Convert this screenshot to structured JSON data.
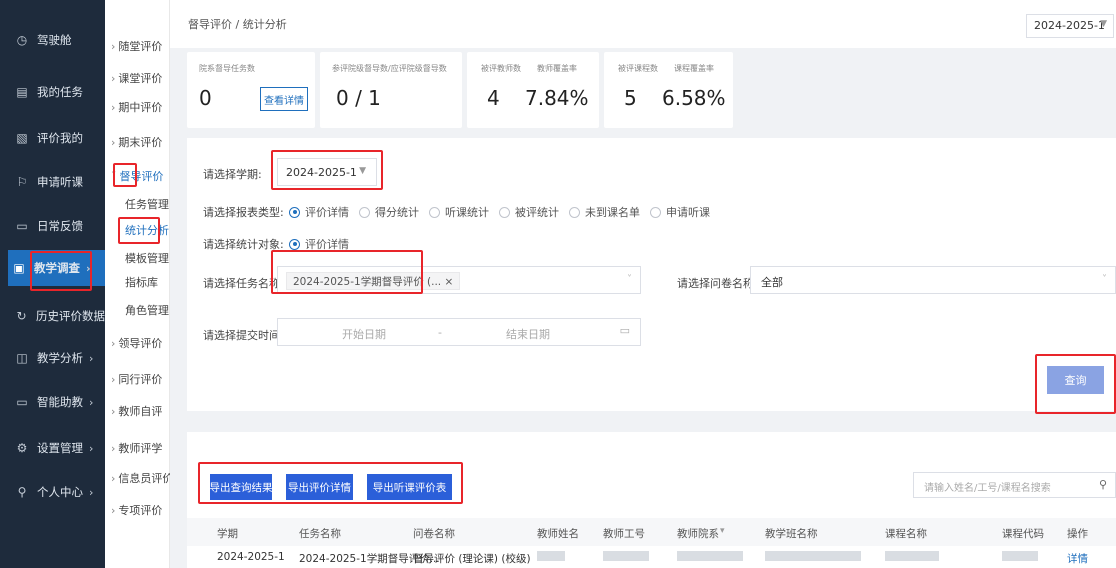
{
  "sidebar": {
    "items": [
      {
        "label": "驾驶舱",
        "icon": "clock-icon"
      },
      {
        "label": "我的任务",
        "icon": "list-icon"
      },
      {
        "label": "评价我的",
        "icon": "evaluate-icon"
      },
      {
        "label": "申请听课",
        "icon": "flag-icon"
      },
      {
        "label": "日常反馈",
        "icon": "feedback-icon"
      },
      {
        "label": "教学调查",
        "icon": "survey-icon",
        "arrow": "›"
      },
      {
        "label": "历史评价数据",
        "icon": "history-icon"
      },
      {
        "label": "教学分析",
        "icon": "chart-icon",
        "arrow": "›"
      },
      {
        "label": "智能助教",
        "icon": "monitor-icon",
        "arrow": "›"
      },
      {
        "label": "设置管理",
        "icon": "settings-icon",
        "arrow": "›"
      },
      {
        "label": "个人中心",
        "icon": "user-icon",
        "arrow": "›"
      }
    ]
  },
  "submenu": {
    "items": [
      {
        "label": "随堂评价"
      },
      {
        "label": "课堂评价"
      },
      {
        "label": "期中评价"
      },
      {
        "label": "期末评价"
      },
      {
        "label": "督导评价"
      },
      {
        "label": "领导评价"
      },
      {
        "label": "同行评价"
      },
      {
        "label": "教师自评"
      },
      {
        "label": "教师评学"
      },
      {
        "label": "信息员评价"
      },
      {
        "label": "专项评价"
      }
    ],
    "children": [
      "任务管理",
      "统计分析",
      "模板管理",
      "指标库",
      "角色管理"
    ]
  },
  "header": {
    "breadcrumb": "督导评价 / 统计分析",
    "term": "2024-2025-1"
  },
  "stats": [
    {
      "label": "院系督导任务数",
      "value": "0",
      "button": "查看详情"
    },
    {
      "label": "参评院级督导数/应评院级督导数",
      "value": "0 / 1"
    },
    {
      "label": "被评教师数",
      "value": "4"
    },
    {
      "label": "教师覆盖率",
      "value": "7.84%"
    },
    {
      "label": "被评课程数",
      "value": "5"
    },
    {
      "label": "课程覆盖率",
      "value": "6.58%"
    }
  ],
  "filters": {
    "term_label": "请选择学期:",
    "term_value": "2024-2025-1",
    "report_type_label": "请选择报表类型:",
    "report_types": [
      "评价详情",
      "得分统计",
      "听课统计",
      "被评统计",
      "未到课名单",
      "申请听课"
    ],
    "target_label": "请选择统计对象:",
    "target_value": "评价详情",
    "task_label": "请选择任务名称:",
    "task_tag": "2024-2025-1学期督导评价 (... ×",
    "questionnaire_label": "请选择问卷名称:",
    "questionnaire_value": "全部",
    "time_label": "请选择提交时间:",
    "start_placeholder": "开始日期",
    "separator": "-",
    "end_placeholder": "结束日期",
    "query_button": "查询"
  },
  "table": {
    "export_buttons": [
      "导出查询结果",
      "导出评价详情",
      "导出听课评价表"
    ],
    "search_placeholder": "请输入姓名/工号/课程名搜索",
    "columns": [
      "学期",
      "任务名称",
      "问卷名称",
      "教师姓名",
      "教师工号",
      "教师院系",
      "教学班名称",
      "课程名称",
      "课程代码",
      "操作"
    ],
    "rows": [
      {
        "term": "2024-2025-1",
        "task": "2024-2025-1学期督导评价...",
        "questionnaire": "督导评价 (理论课) (校级)",
        "action": "详情"
      }
    ]
  },
  "colors": {
    "sidebar_bg": "#1e2b3c",
    "accent": "#1f6fbd",
    "highlight": "#e8252a",
    "active_bar": "#35b46a"
  }
}
